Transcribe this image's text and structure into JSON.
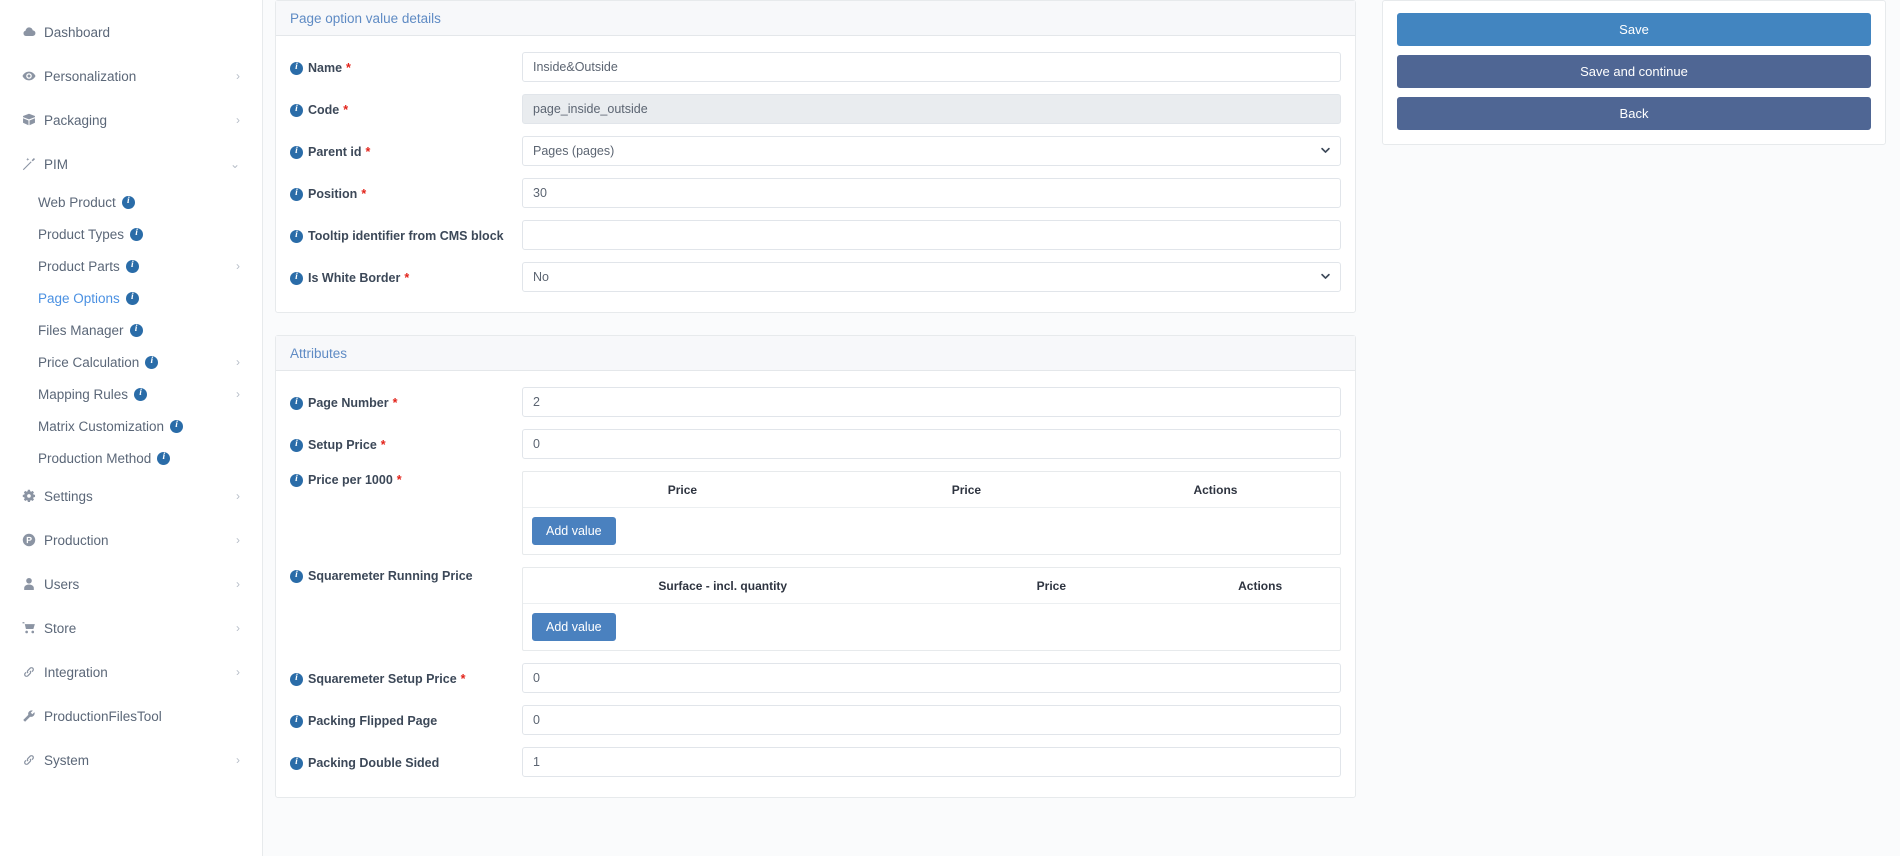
{
  "sidebar": {
    "items": [
      {
        "label": "Dashboard",
        "icon": "cloud-icon",
        "caret": "",
        "level": 0,
        "active": false
      },
      {
        "label": "Personalization",
        "icon": "eye-icon",
        "caret": "right",
        "level": 0,
        "active": false
      },
      {
        "label": "Packaging",
        "icon": "box-icon",
        "caret": "right",
        "level": 0,
        "active": false
      },
      {
        "label": "PIM",
        "icon": "wand-icon",
        "caret": "down",
        "level": 0,
        "active": false
      },
      {
        "label": "Web Product",
        "icon": "",
        "caret": "",
        "level": 1,
        "active": false,
        "info": true
      },
      {
        "label": "Product Types",
        "icon": "",
        "caret": "",
        "level": 1,
        "active": false,
        "info": true
      },
      {
        "label": "Product Parts",
        "icon": "",
        "caret": "right",
        "level": 1,
        "active": false,
        "info": true
      },
      {
        "label": "Page Options",
        "icon": "",
        "caret": "",
        "level": 1,
        "active": true,
        "info": true
      },
      {
        "label": "Files Manager",
        "icon": "",
        "caret": "",
        "level": 1,
        "active": false,
        "info": true
      },
      {
        "label": "Price Calculation",
        "icon": "",
        "caret": "right",
        "level": 1,
        "active": false,
        "info": true
      },
      {
        "label": "Mapping Rules",
        "icon": "",
        "caret": "right",
        "level": 1,
        "active": false,
        "info": true
      },
      {
        "label": "Matrix Customization",
        "icon": "",
        "caret": "",
        "level": 1,
        "active": false,
        "info": true
      },
      {
        "label": "Production Method",
        "icon": "",
        "caret": "",
        "level": 1,
        "active": false,
        "info": true
      },
      {
        "label": "Settings",
        "icon": "gears-icon",
        "caret": "right",
        "level": 0,
        "active": false
      },
      {
        "label": "Production",
        "icon": "circle-p-icon",
        "caret": "right",
        "level": 0,
        "active": false
      },
      {
        "label": "Users",
        "icon": "user-icon",
        "caret": "right",
        "level": 0,
        "active": false
      },
      {
        "label": "Store",
        "icon": "cart-icon",
        "caret": "right",
        "level": 0,
        "active": false
      },
      {
        "label": "Integration",
        "icon": "link-icon",
        "caret": "right",
        "level": 0,
        "active": false
      },
      {
        "label": "ProductionFilesTool",
        "icon": "wrench-icon",
        "caret": "",
        "level": 0,
        "active": false
      },
      {
        "label": "System",
        "icon": "link-icon",
        "caret": "right",
        "level": 0,
        "active": false
      }
    ]
  },
  "details_card": {
    "title": "Page option value details",
    "fields": [
      {
        "label": "Name",
        "required": true,
        "type": "text",
        "value": "Inside&Outside",
        "readonly": false
      },
      {
        "label": "Code",
        "required": true,
        "type": "text",
        "value": "page_inside_outside",
        "readonly": true
      },
      {
        "label": "Parent id",
        "required": true,
        "type": "select",
        "value": "Pages (pages)",
        "readonly": false
      },
      {
        "label": "Position",
        "required": true,
        "type": "text",
        "value": "30",
        "readonly": false
      },
      {
        "label": "Tooltip identifier from CMS block",
        "required": false,
        "type": "text",
        "value": "",
        "readonly": false
      },
      {
        "label": "Is White Border",
        "required": true,
        "type": "select",
        "value": "No",
        "readonly": false
      }
    ]
  },
  "attributes_card": {
    "title": "Attributes",
    "fields": [
      {
        "label": "Page Number",
        "required": true,
        "type": "text",
        "value": "2"
      },
      {
        "label": "Setup Price",
        "required": true,
        "type": "text",
        "value": "0"
      }
    ],
    "tables": [
      {
        "label": "Price per 1000",
        "required": true,
        "columns": [
          "Price",
          "Price",
          "Actions"
        ],
        "rows": [],
        "add_label": "Add value"
      },
      {
        "label": "Squaremeter Running Price",
        "required": false,
        "columns": [
          "Surface - incl. quantity",
          "Price",
          "Actions"
        ],
        "rows": [],
        "add_label": "Add value"
      }
    ],
    "fields_bottom": [
      {
        "label": "Squaremeter Setup Price",
        "required": true,
        "type": "text",
        "value": "0"
      },
      {
        "label": "Packing Flipped Page",
        "required": false,
        "type": "text",
        "value": "0"
      },
      {
        "label": "Packing Double Sided",
        "required": false,
        "type": "text",
        "value": "1"
      }
    ]
  },
  "actions": {
    "save": "Save",
    "save_and_continue": "Save and continue",
    "back": "Back"
  },
  "colors": {
    "accent": "#4285c0",
    "accent_dark": "#4f6694",
    "link": "#4a90e2",
    "required": "#e2231a",
    "header_text": "#5f8bc4"
  }
}
